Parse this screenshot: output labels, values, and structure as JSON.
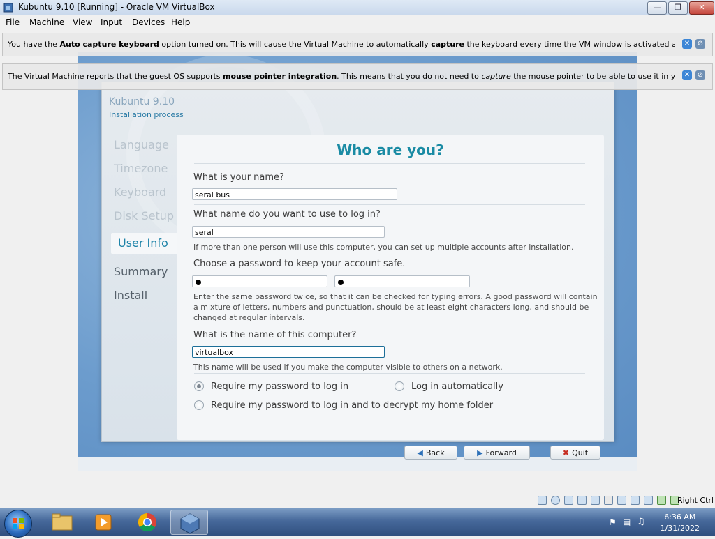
{
  "window": {
    "title": "Kubuntu 9.10 [Running] - Oracle VM VirtualBox"
  },
  "menu": [
    "File",
    "Machine",
    "View",
    "Input",
    "Devices",
    "Help"
  ],
  "notifications": {
    "keyboard": {
      "pre": "You have the ",
      "b1": "Auto capture keyboard",
      "mid": " option turned on. This will cause the Virtual Machine to automatically ",
      "b2": "capture",
      "post": " the keyboard every time the VM window is activated and make it unavailable to"
    },
    "mouse": {
      "pre": "The Virtual Machine reports that the guest OS supports ",
      "b1": "mouse pointer integration",
      "mid": ". This means that you do not need to ",
      "i1": "capture",
      "post": " the mouse pointer to be able to use it in your guest OS -- all mouse"
    }
  },
  "installer": {
    "title": "Kubuntu 9.10",
    "subtitle": "Installation process",
    "steps": [
      {
        "label": "Language"
      },
      {
        "label": "Timezone"
      },
      {
        "label": "Keyboard"
      },
      {
        "label": "Disk Setup"
      },
      {
        "label": "User Info"
      },
      {
        "label": "Summary"
      },
      {
        "label": "Install"
      }
    ],
    "active_step": "User Info",
    "heading": "Who are you?",
    "q_name": "What is your name?",
    "name_value": "seral bus",
    "q_login": "What name do you want to use to log in?",
    "login_value": "seral",
    "login_hint": "If more than one person will use this computer, you can set up multiple accounts after installation.",
    "q_password": "Choose a password to keep your account safe.",
    "password_hint": "Enter the same password twice, so that it can be checked for typing errors. A good password will contain a mixture of letters, numbers and punctuation, should be at least eight characters long, and should be changed at regular intervals.",
    "q_computer": "What is the name of this computer?",
    "computer_value": "virtualbox",
    "computer_hint": "This name will be used if you make the computer visible to others on a network.",
    "radio_require": "Require my password to log in",
    "radio_auto": "Log in automatically",
    "radio_decrypt": "Require my password to log in and to decrypt my home folder",
    "selected_option": "Require my password to log in",
    "btn_back": "Back",
    "btn_forward": "Forward",
    "btn_quit": "Quit"
  },
  "statusbar": {
    "host_key": "Right Ctrl"
  },
  "taskbar": {
    "time": "6:36 AM",
    "date": "1/31/2022"
  }
}
